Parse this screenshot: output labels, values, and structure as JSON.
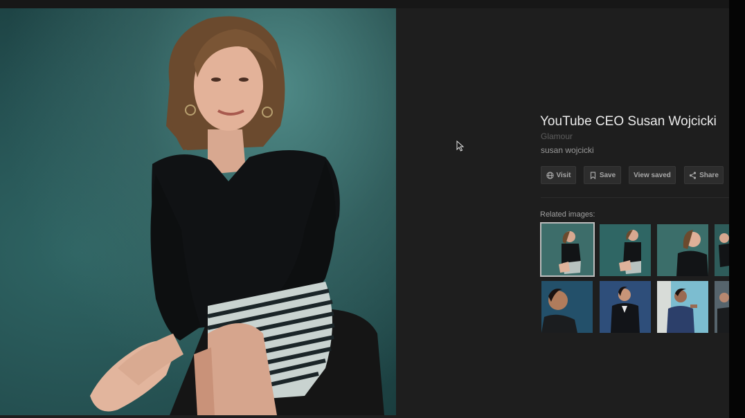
{
  "panel": {
    "title": "YouTube CEO Susan Wojcicki",
    "source": "Glamour",
    "query": "susan wojcicki"
  },
  "actions": {
    "visit": {
      "label": "Visit",
      "icon": "globe-icon"
    },
    "save": {
      "label": "Save",
      "icon": "bookmark-icon"
    },
    "view_saved": {
      "label": "View saved"
    },
    "share": {
      "label": "Share",
      "icon": "share-icon"
    }
  },
  "related": {
    "label": "Related images:",
    "selected_index": 0
  },
  "colors": {
    "background": "#1e1e1e",
    "title": "#ececec",
    "source": "#5d5d5d",
    "button_bg": "#2d2d2d",
    "photo_backdrop": "#2f6564"
  }
}
